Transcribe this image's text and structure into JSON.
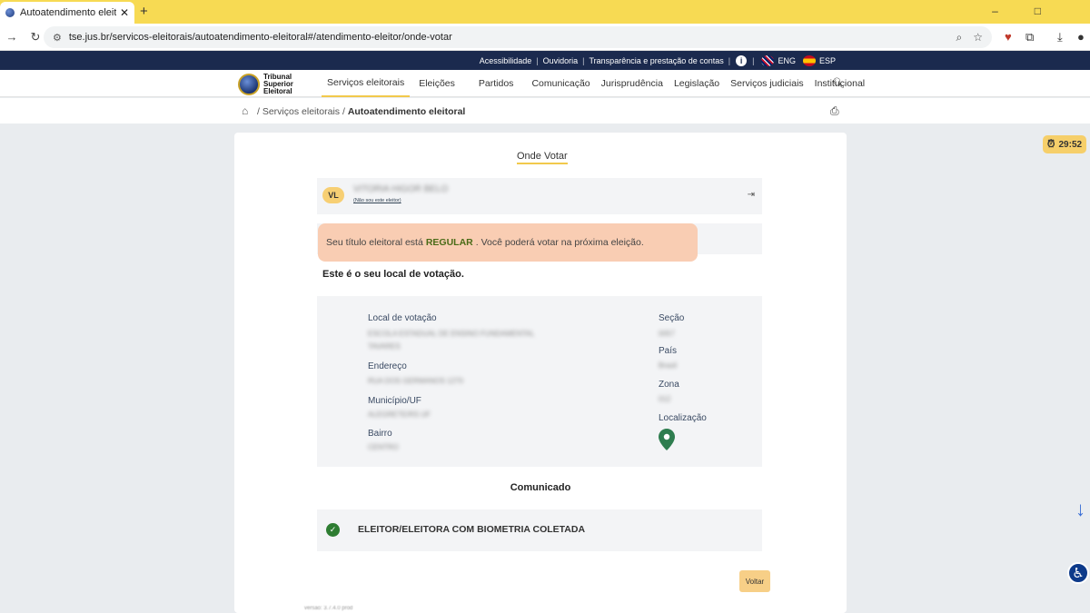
{
  "browser": {
    "tab_title": "Autoatendimento eleitoral — TSE",
    "new_tab": "+",
    "close_tab": "✕",
    "url": "tse.jus.br/servicos-eleitorais/autoatendimento-eleitoral#/atendimento-eleitor/onde-votar"
  },
  "topbar": {
    "links": [
      "Acessibilidade",
      "Ouvidoria",
      "Transparência e prestação de contas"
    ],
    "info": "i",
    "lang_en": "ENG",
    "lang_es": "ESP"
  },
  "logo": {
    "line1": "Tribunal",
    "line2": "Superior",
    "line3": "Eleitoral"
  },
  "nav": {
    "items": [
      "Serviços eleitorais",
      "Eleições",
      "Partidos",
      "Comunicação",
      "Jurisprudência",
      "Legislação",
      "Serviços judiciais",
      "Institucional"
    ]
  },
  "breadcrumb": {
    "sep": "/",
    "item1": "Serviços eleitorais",
    "item2": "Autoatendimento eleitoral"
  },
  "timer": "29:52",
  "page": {
    "title": "Onde Votar",
    "user_initials": "VL",
    "user_name": "VITORIA HIGOR BELO",
    "not_me": "(Não sou este eleitor)",
    "status_prefix": "Seu título eleitoral está",
    "status_value": "REGULAR",
    "status_suffix": ". Você poderá votar na próxima eleição.",
    "local_title": "Este é o seu local de votação.",
    "fields": {
      "local_label": "Local de votação",
      "local_value_1": "ESCOLA ESTADUAL DE ENSINO FUNDAMENTAL",
      "local_value_2": "TAVARES",
      "endereco_label": "Endereço",
      "endereco_value": "RUA DOS GERMANOS 1270",
      "municipio_label": "Município/UF",
      "municipio_value": "ALEGRETE/RS UF",
      "bairro_label": "Bairro",
      "bairro_value": "CENTRO",
      "secao_label": "Seção",
      "secao_value": "0057",
      "pais_label": "País",
      "pais_value": "Brasil",
      "zona_label": "Zona",
      "zona_value": "012",
      "localizacao_label": "Localização"
    },
    "comunicado_title": "Comunicado",
    "comunicado_text": "ELEITOR/ELEITORA COM BIOMETRIA COLETADA",
    "voltar": "Voltar",
    "versao": "versão: 3.7.4.0 prod"
  },
  "colors": {
    "accent": "#f2c94c",
    "navy": "#1b2a4e",
    "status_bg": "#f9cdb3",
    "success": "#2e7d32"
  }
}
